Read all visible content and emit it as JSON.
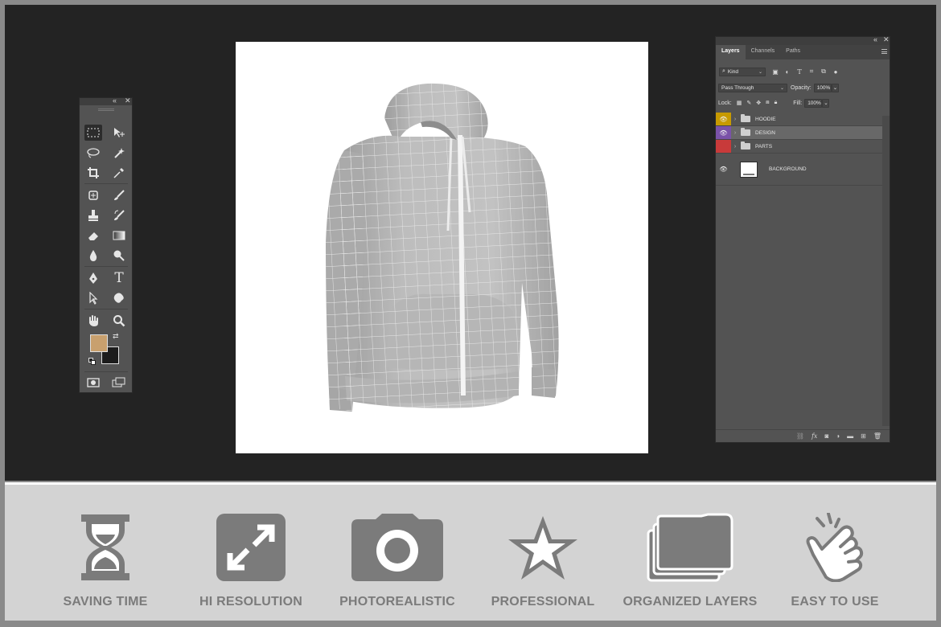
{
  "layers_panel": {
    "tabs": [
      {
        "label": "Layers"
      },
      {
        "label": "Channels"
      },
      {
        "label": "Paths"
      }
    ],
    "filter_kind": "Kind",
    "blend_mode": "Pass Through",
    "opacity_label": "Opacity:",
    "opacity_value": "100%",
    "lock_label": "Lock:",
    "fill_label": "Fill:",
    "fill_value": "100%",
    "layers": [
      {
        "name": "HOODIE",
        "color": "#c79a00",
        "type": "group"
      },
      {
        "name": "DESIGN",
        "color": "#7a52a8",
        "type": "group"
      },
      {
        "name": "PARTS",
        "color": "#c83a3a",
        "type": "group"
      },
      {
        "name": "BACKGROUND",
        "color": "",
        "type": "layer"
      }
    ]
  },
  "toolbox": {
    "foreground_color": "#c8a06e",
    "background_color": "#1c1c1c",
    "tools": [
      "rectangular-marquee",
      "move",
      "lasso",
      "magic-wand",
      "crop",
      "eyedropper",
      "healing-brush",
      "brush",
      "clone-stamp",
      "history-brush",
      "eraser",
      "gradient",
      "blur",
      "dodge",
      "pen",
      "type",
      "path-selection",
      "custom-shape",
      "hand",
      "zoom"
    ]
  },
  "canvas": {
    "subject": "hoodie-mockup",
    "garment_color": "#b9b9b9"
  },
  "features": [
    {
      "label": "SAVING TIME",
      "icon": "hourglass-icon"
    },
    {
      "label": "HI RESOLUTION",
      "icon": "expand-icon"
    },
    {
      "label": "PHOTOREALISTIC",
      "icon": "camera-icon"
    },
    {
      "label": "PROFESSIONAL",
      "icon": "star-icon"
    },
    {
      "label": "ORGANIZED LAYERS",
      "icon": "folders-icon"
    },
    {
      "label": "EASY TO USE",
      "icon": "pointer-hand-icon"
    }
  ],
  "colors": {
    "workspace": "#232323",
    "panel": "#535353",
    "feature_strip": "#d3d3d3",
    "feature_icon": "#7b7b7b"
  }
}
